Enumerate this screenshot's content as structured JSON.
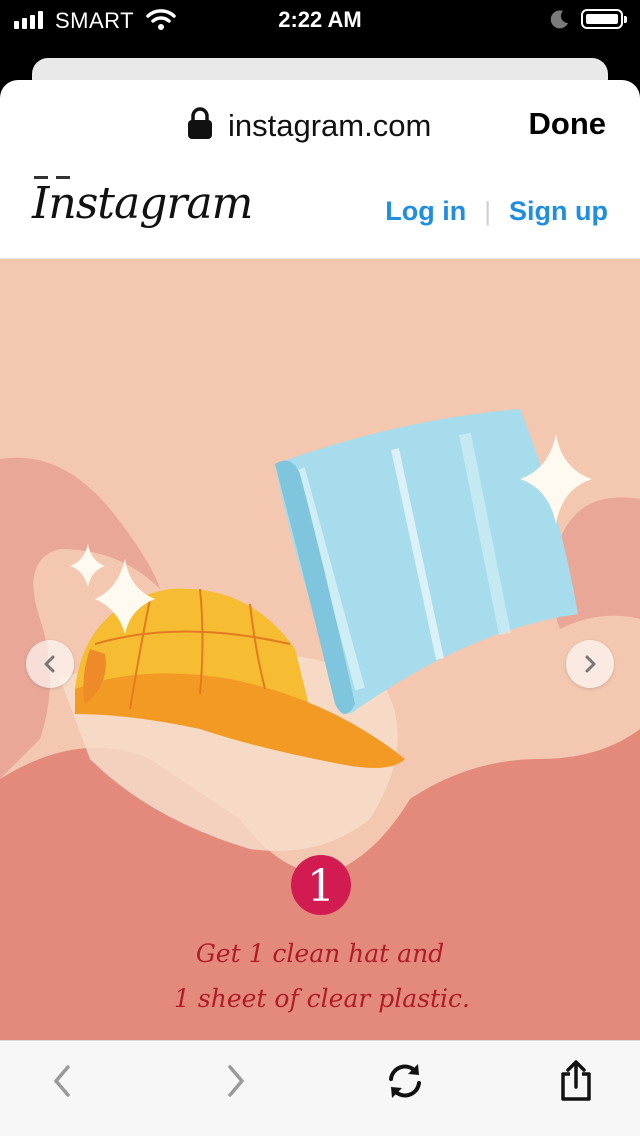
{
  "status_bar": {
    "carrier": "SMART",
    "time": "2:22 AM"
  },
  "browser": {
    "url": "instagram.com",
    "done_label": "Done"
  },
  "instagram": {
    "logo": "Instagram",
    "login_label": "Log in",
    "signup_label": "Sign up"
  },
  "post": {
    "step_number": "1",
    "caption_line1": "Get 1 clean hat and",
    "caption_line2": "1 sheet of clear plastic."
  },
  "icons": [
    "signal-icon",
    "wifi-icon",
    "moon-icon",
    "battery-icon",
    "lock-icon",
    "chevron-left-icon",
    "chevron-right-icon",
    "back-arrow-icon",
    "forward-arrow-icon",
    "refresh-icon",
    "share-icon"
  ],
  "colors": {
    "link_blue": "#1f8ede",
    "caption_red": "#b01c25",
    "badge_pink": "#d21b50",
    "peach": "#f3c7b0",
    "coral": "#e48a7d"
  }
}
